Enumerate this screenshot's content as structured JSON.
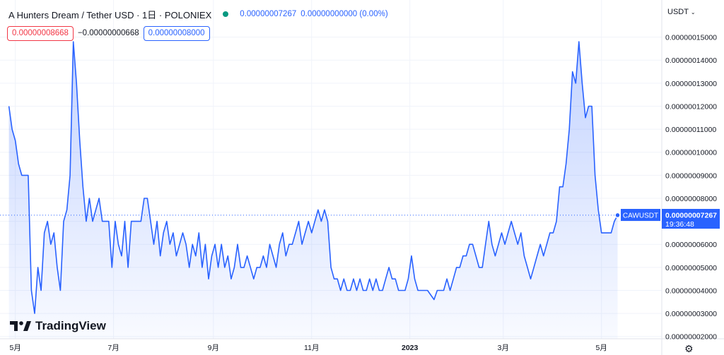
{
  "header": {
    "symbol_title": "A Hunters Dream / Tether USD · 1日 · POLONIEX",
    "status_color": "#089981",
    "last_price": "0.00000007267",
    "change": "0.00000000000 (0.00%)",
    "sell_price": "0.00000008668",
    "spread": "−0.00000000668",
    "buy_price": "0.00000008000",
    "currency": "USDT"
  },
  "price_tag": {
    "ticker": "CAWUSDT",
    "value": "0.00000007267",
    "countdown": "19:36:48"
  },
  "branding": {
    "logo_text": "TradingView"
  },
  "chart_data": {
    "type": "area",
    "series": [
      {
        "ticker": "CAWUSDT",
        "color": "#2962ff",
        "x": [
          0,
          2,
          4,
          6,
          8,
          10,
          12,
          14,
          16,
          18,
          20,
          22,
          24,
          26,
          28,
          30,
          32,
          34,
          36,
          38,
          40,
          42,
          44,
          46,
          48,
          50,
          52,
          54,
          56,
          58,
          60,
          62,
          64,
          66,
          68,
          70,
          72,
          74,
          76,
          78,
          80,
          82,
          84,
          86,
          88,
          90,
          92,
          94,
          96,
          98,
          100,
          102,
          104,
          106,
          108,
          110,
          112,
          114,
          116,
          118,
          120,
          122,
          124,
          126,
          128,
          130,
          132,
          134,
          136,
          138,
          140,
          142,
          144,
          146,
          148,
          150,
          152,
          154,
          156,
          158,
          160,
          162,
          164,
          166,
          168,
          170,
          172,
          174,
          176,
          178,
          180,
          182,
          184,
          186,
          188,
          190,
          192,
          194,
          196,
          198,
          200,
          202,
          204,
          206,
          208,
          210,
          212,
          214,
          216,
          218,
          220,
          222,
          224,
          226,
          228,
          230,
          232,
          234,
          236,
          238,
          240,
          242,
          244,
          246,
          248,
          250,
          252,
          254,
          256,
          258,
          260,
          262,
          264,
          266,
          268,
          270,
          272,
          274,
          276,
          278,
          280,
          282,
          284,
          286,
          288,
          290,
          292,
          294,
          296,
          298,
          300,
          302,
          304,
          306,
          308,
          310,
          312,
          314,
          316,
          318,
          320,
          322,
          324,
          326,
          328,
          330,
          332,
          334,
          336,
          338,
          340,
          342,
          344,
          346,
          348,
          350,
          352,
          354,
          356,
          358,
          360,
          362,
          364,
          366,
          368,
          370,
          372,
          374,
          376,
          378
        ],
        "values": [
          12.0,
          11.0,
          10.5,
          9.5,
          9.0,
          9.0,
          9.0,
          4.0,
          3.0,
          5.0,
          4.0,
          6.5,
          7.0,
          6.0,
          6.5,
          5.0,
          4.0,
          7.0,
          7.5,
          9.0,
          14.8,
          13.0,
          10.5,
          8.5,
          7.0,
          8.0,
          7.0,
          7.5,
          8.0,
          7.0,
          7.0,
          7.0,
          5.0,
          7.0,
          6.0,
          5.5,
          7.0,
          5.0,
          7.0,
          7.0,
          7.0,
          7.0,
          8.0,
          8.0,
          7.0,
          6.0,
          7.0,
          5.5,
          6.5,
          7.0,
          6.0,
          6.5,
          5.5,
          6.0,
          6.5,
          6.0,
          5.0,
          6.0,
          5.5,
          6.5,
          5.0,
          6.0,
          4.5,
          5.5,
          6.0,
          5.0,
          6.0,
          5.0,
          5.5,
          4.5,
          5.0,
          6.0,
          5.0,
          5.0,
          5.5,
          5.0,
          4.5,
          5.0,
          5.0,
          5.5,
          5.0,
          6.0,
          5.5,
          5.0,
          6.0,
          6.5,
          5.5,
          6.0,
          6.0,
          6.5,
          7.0,
          6.0,
          6.5,
          7.0,
          6.5,
          7.0,
          7.5,
          7.0,
          7.5,
          7.0,
          5.0,
          4.5,
          4.5,
          4.0,
          4.5,
          4.0,
          4.0,
          4.5,
          4.0,
          4.5,
          4.0,
          4.0,
          4.5,
          4.0,
          4.5,
          4.0,
          4.0,
          4.5,
          5.0,
          4.5,
          4.5,
          4.0,
          4.0,
          4.0,
          4.5,
          5.5,
          4.5,
          4.0,
          4.0,
          4.0,
          4.0,
          3.8,
          3.6,
          4.0,
          4.0,
          4.0,
          4.5,
          4.0,
          4.5,
          5.0,
          5.0,
          5.5,
          5.5,
          6.0,
          6.0,
          5.5,
          5.0,
          5.0,
          6.0,
          7.0,
          6.0,
          5.5,
          6.0,
          6.5,
          6.0,
          6.5,
          7.0,
          6.5,
          6.0,
          6.5,
          5.5,
          5.0,
          4.5,
          5.0,
          5.5,
          6.0,
          5.5,
          6.0,
          6.5,
          6.5,
          7.0,
          8.5,
          8.5,
          9.5,
          11.0,
          13.5,
          13.0,
          14.8,
          13.0,
          11.5,
          12.0,
          12.0,
          9.0,
          7.5,
          6.5,
          6.5,
          6.5,
          6.5,
          7.0,
          7.267
        ],
        "last_value": 7.267
      }
    ],
    "x_ticks": [
      {
        "label": "5月",
        "x": 4
      },
      {
        "label": "7月",
        "x": 65
      },
      {
        "label": "9月",
        "x": 127
      },
      {
        "label": "11月",
        "x": 188
      },
      {
        "label": "2023",
        "x": 249,
        "bold": true
      },
      {
        "label": "3月",
        "x": 307
      },
      {
        "label": "5月",
        "x": 368
      }
    ],
    "y_ticks": [
      "0.00000002000",
      "0.00000003000",
      "0.00000004000",
      "0.00000005000",
      "0.00000006000",
      "0.00000007000",
      "0.00000008000",
      "0.00000009000",
      "0.00000010000",
      "0.00000011000",
      "0.00000012000",
      "0.00000013000",
      "0.00000014000",
      "0.00000015000"
    ],
    "y_tick_values": [
      2,
      3,
      4,
      5,
      6,
      7,
      8,
      9,
      10,
      11,
      12,
      13,
      14,
      15
    ],
    "y_unit_scale": 1e-08,
    "ylim": [
      1.9,
      16.0
    ],
    "xlim": [
      -2,
      405
    ],
    "grid": true,
    "fill_gradient": true,
    "price_line_dotted": true
  }
}
